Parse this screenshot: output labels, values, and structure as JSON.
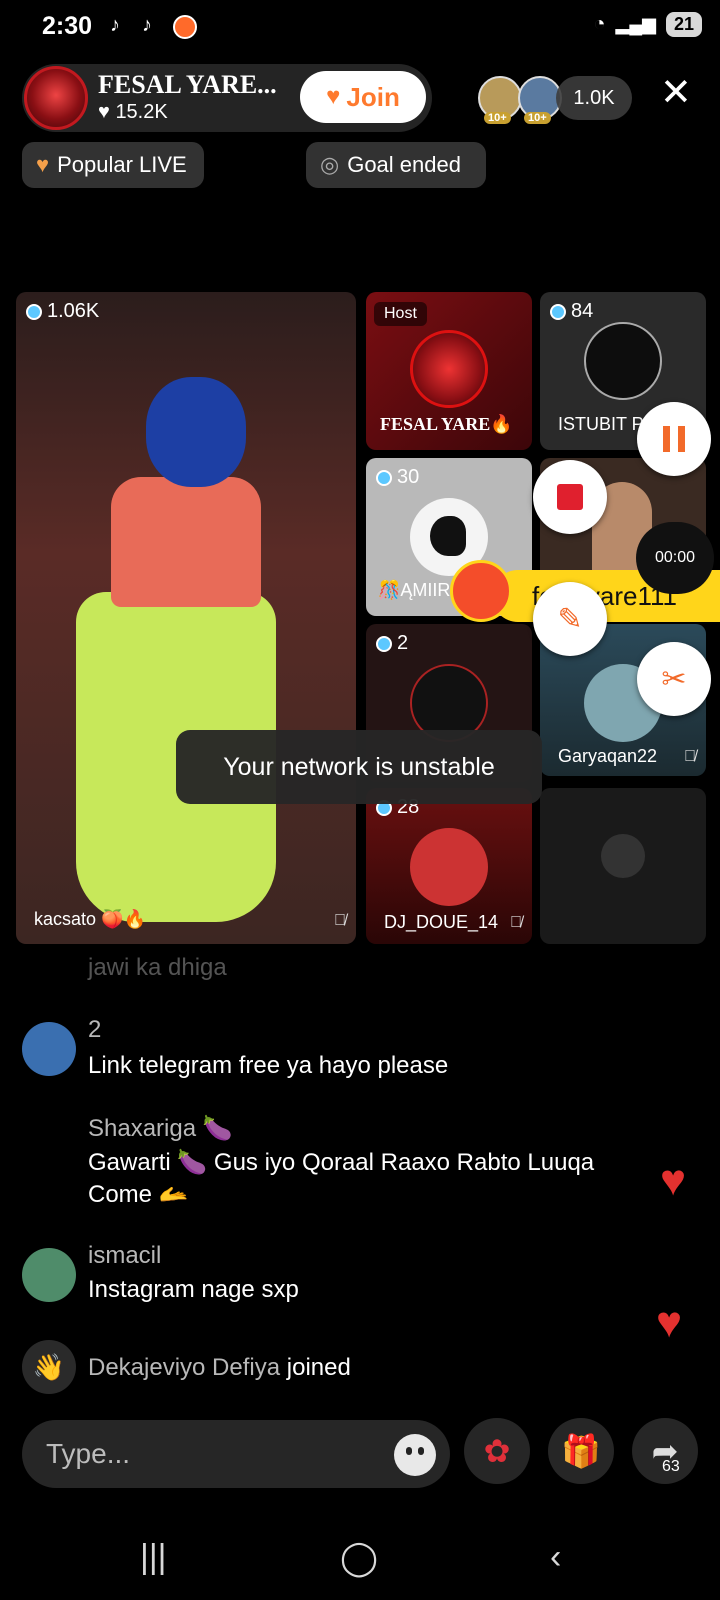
{
  "status_bar": {
    "time": "2:30",
    "battery": "21"
  },
  "host": {
    "name": "FESAL YARE...",
    "likes": "15.2K",
    "join_label": "Join"
  },
  "viewers": {
    "badge_1": "10+",
    "badge_2": "10+",
    "count": "1.0K"
  },
  "chips": {
    "popular": "Popular LIVE",
    "goal": "Goal ended"
  },
  "grid": {
    "main": {
      "count": "1.06K",
      "name": "kacsato 🍑🔥"
    },
    "host_tile": {
      "badge": "Host",
      "name": "FESAL YARE🔥"
    },
    "tile_istubit": {
      "count": "84",
      "name": "ISTUBIT P"
    },
    "tile_amiir": {
      "count": "30",
      "name": "🎊ĄMIIR"
    },
    "tile_moayzer": {
      "count": "2"
    },
    "tile_garyaqan": {
      "name": "Garyaqan22"
    },
    "tile_dj": {
      "count": "28",
      "name": "DJ_DOUE_14"
    }
  },
  "floating": {
    "timer": "00:00",
    "banner": "fesalyare111"
  },
  "toast": "Your network is unstable",
  "chat": [
    {
      "user": "",
      "message": "jawi ka dhiga"
    },
    {
      "user": "2",
      "message": "Link telegram free ya hayo please"
    },
    {
      "user": "Shaxariga 🍆",
      "message": "Gawarti 🍆 Gus iyo Qoraal Raaxo Rabto Luuqa",
      "message_2": "Come 🫴"
    },
    {
      "user": "ismacil",
      "message": "Instagram nage sxp"
    },
    {
      "user": "Dekajeviyo Defiya",
      "message": "joined"
    }
  ],
  "input": {
    "placeholder": "Type...",
    "share_count": "63"
  },
  "colors": {
    "accent": "#fe7a2e",
    "heart": "#e4312f",
    "banner": "#ffd51a"
  }
}
